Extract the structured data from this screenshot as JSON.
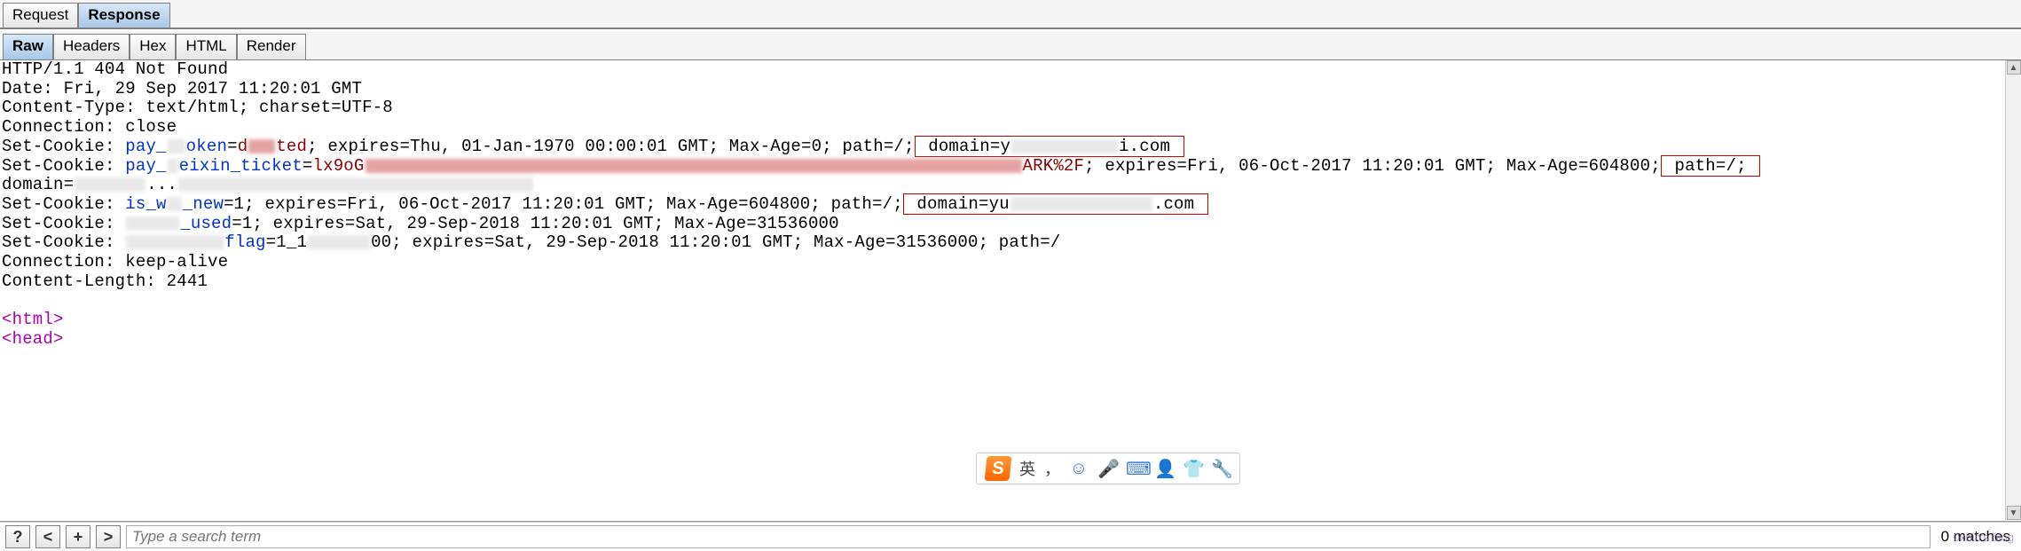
{
  "top_tabs": {
    "request": "Request",
    "response": "Response"
  },
  "sub_tabs": {
    "raw": "Raw",
    "headers": "Headers",
    "hex": "Hex",
    "html": "HTML",
    "render": "Render"
  },
  "response": {
    "status_line": "HTTP/1.1 404 Not Found",
    "date_header": "Date: Fri, 29 Sep 2017 11:20:01 GMT",
    "content_type": "Content-Type: text/html; charset=UTF-8",
    "connection1": "Connection: close",
    "sc1": {
      "prefix": "Set-Cookie: ",
      "name": "pay_",
      "name_suffix": "oken",
      "eq": "=",
      "value_vis": "d",
      "value_suffix": "ted",
      "rest_a": "; expires=Thu, 01-Jan-1970 00:00:01 GMT; Max-Age=0; path=/;",
      "domain_a": " domain=y",
      "domain_b": "i.com "
    },
    "sc2": {
      "prefix": "Set-Cookie: ",
      "name": "pay_",
      "name_mid": "eixin_ticket",
      "eq": "=",
      "value_a": "lx9oG",
      "value_b": "ARK%2F",
      "rest": "; expires=Fri, 06-Oct-2017 11:20:01 GMT; Max-Age=604800;",
      "path_box": " path=/; ",
      "domain_prefix": "domain=",
      "domain_dots": "..."
    },
    "sc3": {
      "prefix": "Set-Cookie: ",
      "name": "is_w",
      "name_suffix": "_new",
      "value": "=1; expires=Fri, 06-Oct-2017 11:20:01 GMT; Max-Age=604800; path=/;",
      "domain_a": " domain=yu",
      "domain_b": ".com "
    },
    "sc4": {
      "prefix": "Set-Cookie: ",
      "name_suffix": "_used",
      "rest": "=1; expires=Sat, 29-Sep-2018 11:20:01 GMT; Max-Age=31536000"
    },
    "sc5": {
      "prefix": "Set-Cookie: ",
      "name_suffix": "flag",
      "value_a": "=1_1",
      "value_b": "00",
      "rest": "; expires=Sat, 29-Sep-2018 11:20:01 GMT; Max-Age=31536000; path=/"
    },
    "connection2": "Connection: keep-alive",
    "content_length": "Content-Length: 2441",
    "html_open": "<html>",
    "head_open": "<head>"
  },
  "search": {
    "help": "?",
    "prev": "<",
    "plus": "+",
    "next": ">",
    "placeholder": "Type a search term",
    "matches": "0 matches"
  },
  "ime": {
    "logo": "S",
    "lang": "英",
    "punct": "，",
    "icons": {
      "face": "☺",
      "mic": "🎤",
      "keyboard": "⌨",
      "person": "👤",
      "shirt": "👕",
      "wrench": "🔧"
    }
  },
  "watermark": "0xbin's blog"
}
